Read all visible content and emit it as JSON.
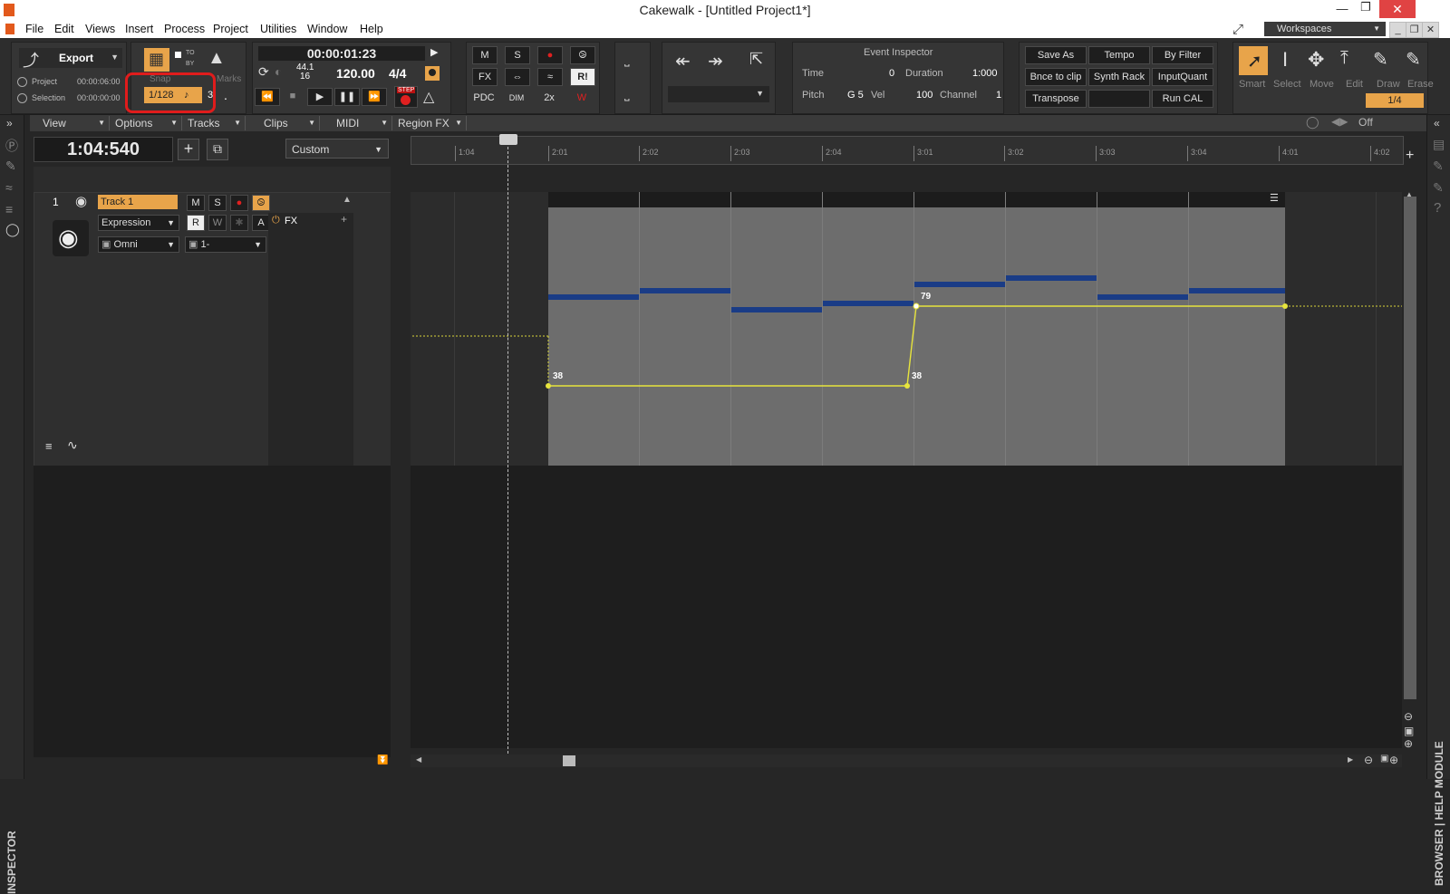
{
  "window": {
    "title": "Cakewalk - [Untitled Project1*]"
  },
  "menu": [
    "File",
    "Edit",
    "Views",
    "Insert",
    "Process",
    "Project",
    "Utilities",
    "Window",
    "Help"
  ],
  "workspaces_label": "Workspaces",
  "controlbar": {
    "export_label": "Export",
    "project_label": "Project",
    "project_time": "00:00:06:00",
    "selection_label": "Selection",
    "selection_time": "00:00:00:00",
    "snap_label": "Snap",
    "snap_value": "1/128",
    "snap_tuplet": "3",
    "snap_dot": ".",
    "to_label": "TO",
    "by_label": "BY",
    "marks_label": "Marks",
    "transport_time": "00:00:01:23",
    "sample_rate": "44.1",
    "bit_depth": "16",
    "tempo": "120.00",
    "meter": "4/4",
    "step_label": "STEP",
    "mix_buttons": [
      "M",
      "S",
      "FX",
      "PDC",
      "DIM",
      "2x",
      "R!"
    ],
    "event_inspector": {
      "title": "Event Inspector",
      "time_label": "Time",
      "time_value": "0",
      "duration_label": "Duration",
      "duration_value": "1:000",
      "pitch_label": "Pitch",
      "pitch_value": "G 5",
      "vel_label": "Vel",
      "vel_value": "100",
      "channel_label": "Channel",
      "channel_value": "1"
    },
    "custom_buttons": [
      "Save As",
      "Tempo",
      "By Filter",
      "Bnce to clip",
      "Synth Rack",
      "InputQuant",
      "Transpose",
      "",
      "Run CAL"
    ],
    "tools": [
      "Smart",
      "Select",
      "Move",
      "Edit",
      "Draw",
      "Erase"
    ],
    "tool_snap": "1/4"
  },
  "trackview_menu": [
    "View",
    "Options",
    "Tracks",
    "Clips",
    "MIDI",
    "Region FX"
  ],
  "off_label": "Off",
  "now_time": "1:04:540",
  "custom_select": "Custom",
  "track": {
    "number": "1",
    "name": "Track 1",
    "m": "M",
    "s": "S",
    "automation": "Expression",
    "r": "R",
    "w": "W",
    "a": "A",
    "fx": "FX",
    "input": "Omni",
    "output": "1-"
  },
  "ruler": [
    "1:04",
    "2:01",
    "2:02",
    "2:03",
    "2:04",
    "3:01",
    "3:02",
    "3:03",
    "3:04",
    "4:01",
    "4:02"
  ],
  "envelope_labels": [
    "38",
    "38",
    "79"
  ],
  "side_labels": {
    "inspector": "INSPECTOR",
    "browser": "BROWSER  |  HELP MODULE"
  }
}
